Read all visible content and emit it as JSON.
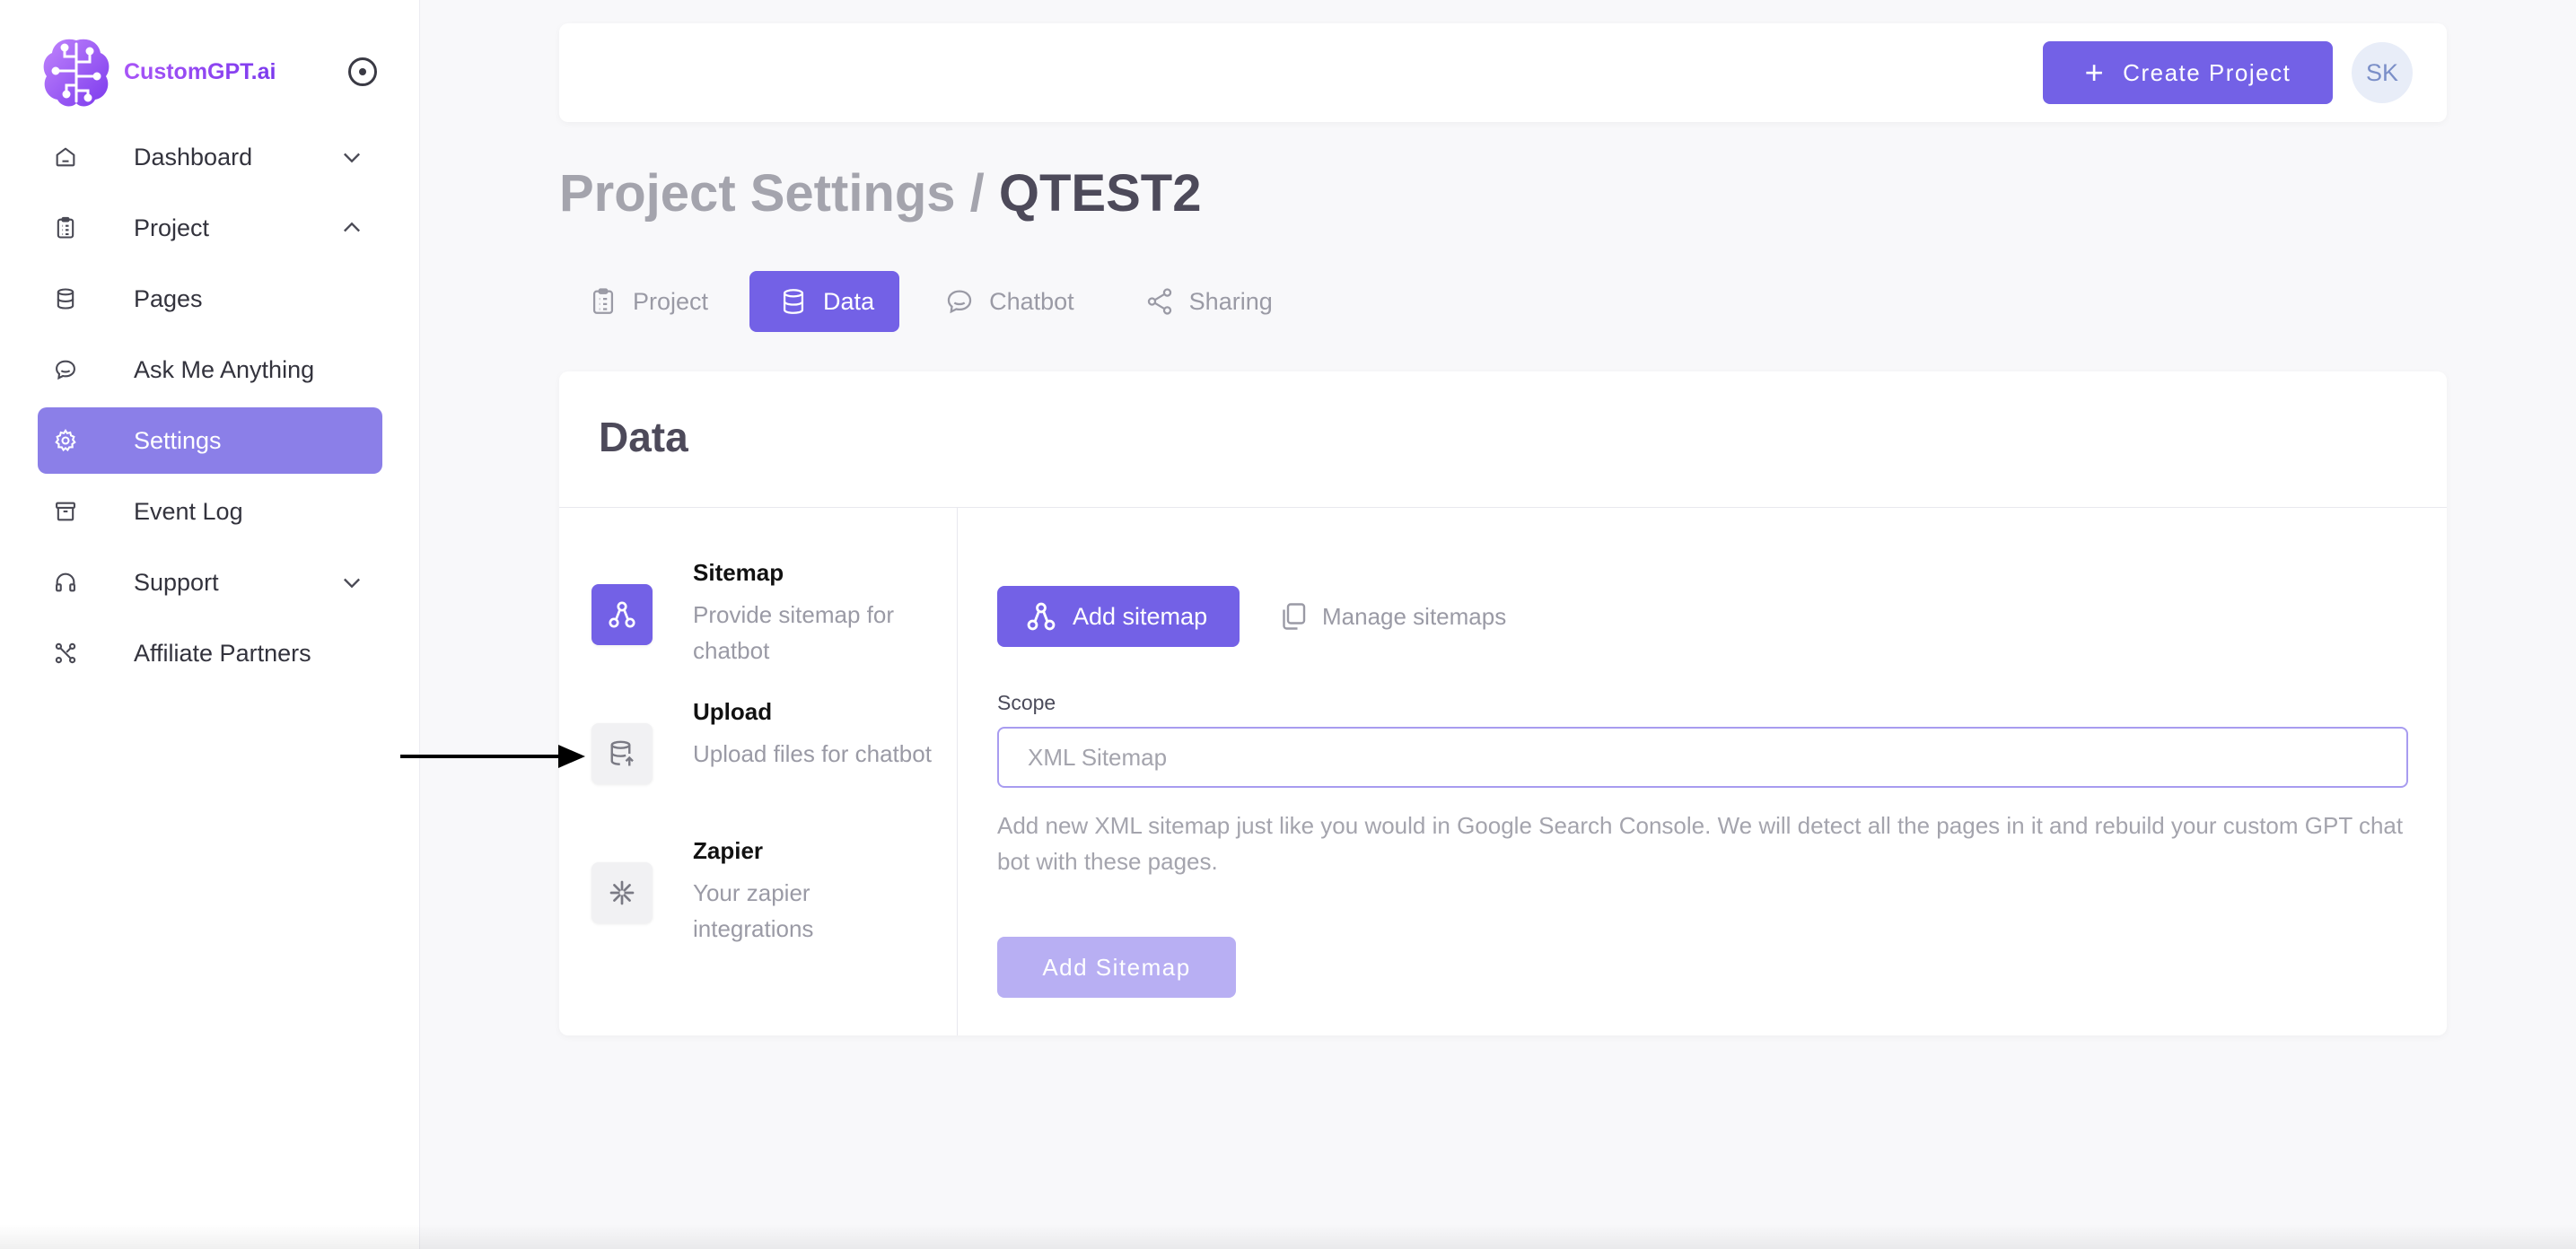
{
  "brand": {
    "name": "CustomGPT.ai"
  },
  "sidebar": {
    "items": [
      {
        "label": "Dashboard",
        "icon": "home-icon",
        "chevron": "down"
      },
      {
        "label": "Project",
        "icon": "clipboard-icon",
        "chevron": "up"
      },
      {
        "label": "Pages",
        "icon": "database-icon"
      },
      {
        "label": "Ask Me Anything",
        "icon": "chat-icon"
      },
      {
        "label": "Settings",
        "icon": "gear-icon",
        "active": true
      },
      {
        "label": "Event Log",
        "icon": "archive-icon"
      },
      {
        "label": "Support",
        "icon": "headphones-icon",
        "chevron": "down"
      },
      {
        "label": "Affiliate Partners",
        "icon": "network-icon"
      }
    ]
  },
  "header": {
    "create_label": "Create Project",
    "avatar_initials": "SK"
  },
  "page": {
    "title_prefix": "Project Settings / ",
    "title_project": "QTEST2"
  },
  "tabs": [
    {
      "label": "Project",
      "icon": "clipboard-icon"
    },
    {
      "label": "Data",
      "icon": "database-icon",
      "active": true
    },
    {
      "label": "Chatbot",
      "icon": "chat-icon"
    },
    {
      "label": "Sharing",
      "icon": "share-icon"
    }
  ],
  "data_card": {
    "title": "Data",
    "sources": [
      {
        "title": "Sitemap",
        "desc": "Provide sitemap for chatbot",
        "icon": "sitemap-icon",
        "active": true
      },
      {
        "title": "Upload",
        "desc": "Upload files for chatbot",
        "icon": "upload-database-icon"
      },
      {
        "title": "Zapier",
        "desc": "Your zapier integrations",
        "icon": "zapier-icon"
      }
    ],
    "subtabs": {
      "add": "Add sitemap",
      "manage": "Manage sitemaps"
    },
    "scope_label": "Scope",
    "scope_placeholder": "XML Sitemap",
    "help": "Add new XML sitemap just like you would in Google Search Console. We will detect all the pages in it and rebuild your custom GPT chat bot with these pages.",
    "submit_label": "Add Sitemap"
  },
  "colors": {
    "accent": "#7361e6",
    "accent_light": "#8b7fe8",
    "disabled": "#b8aff3",
    "brand_gradient": [
      "#a855f7",
      "#7c3aed"
    ]
  }
}
